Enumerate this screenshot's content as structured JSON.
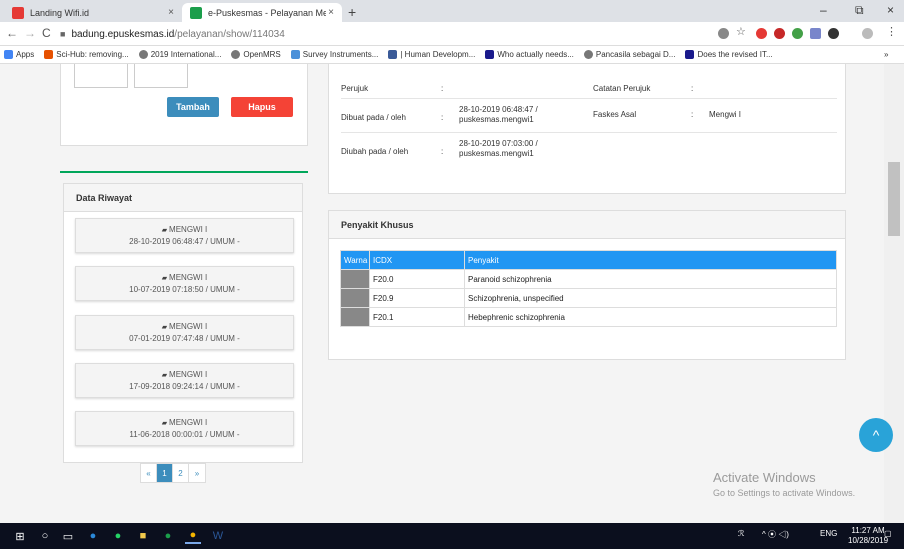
{
  "browser": {
    "tabs": [
      {
        "title": "Landing Wifi.id",
        "close": "×",
        "icon_color": "#e53935"
      },
      {
        "title": "e-Puskesmas - Pelayanan Medis",
        "close": "×",
        "icon_color": "#1b9e4b"
      }
    ],
    "new_tab": "+",
    "window_controls": [
      "–",
      "⧉",
      "×"
    ],
    "nav": {
      "back": "←",
      "forward": "→",
      "reload": "C"
    },
    "url": {
      "host": "badung.epuskesmas.id",
      "path": "/pelayanan/show/114034"
    },
    "bookmarks": [
      {
        "label": "Apps",
        "color": "#4285f4"
      },
      {
        "label": "Sci-Hub: removing...",
        "color": "#e65100"
      },
      {
        "label": "2019 International...",
        "color": "#777777"
      },
      {
        "label": "OpenMRS",
        "color": "#777777"
      },
      {
        "label": "Survey Instruments...",
        "color": "#4a90d9"
      },
      {
        "label": "| Human Developm...",
        "color": "#3a5a98"
      },
      {
        "label": "Who actually needs...",
        "color": "#1a1a8c"
      },
      {
        "label": "Pancasila sebagai D...",
        "color": "#777777"
      },
      {
        "label": "Does the revised IT...",
        "color": "#1a1a8c"
      }
    ],
    "bookmarks_more": "»"
  },
  "left": {
    "add_button": "Tambah",
    "delete_button": "Hapus",
    "riwayat_title": "Data Riwayat",
    "riwayat_items": [
      {
        "title": "MENGWI I",
        "detail": "28-10-2019 06:48:47 / UMUM -"
      },
      {
        "title": "MENGWI I",
        "detail": "10-07-2019 07:18:50 / UMUM -"
      },
      {
        "title": "MENGWI I",
        "detail": "07-01-2019 07:47:48 / UMUM -"
      },
      {
        "title": "MENGWI I",
        "detail": "17-09-2018 09:24:14 / UMUM -"
      },
      {
        "title": "MENGWI I",
        "detail": "11-06-2018 00:00:01 / UMUM -"
      }
    ],
    "pager": {
      "prev": "«",
      "pages": [
        "1",
        "2"
      ],
      "next": "»",
      "current": "1"
    }
  },
  "info": {
    "rows": [
      {
        "label": "Perujuk",
        "sep": ":",
        "value": "",
        "label2": "Catatan Perujuk",
        "sep2": ":",
        "value2": ""
      },
      {
        "label": "Dibuat pada / oleh",
        "sep": ":",
        "value": "28-10-2019 06:48:47 / puskesmas.mengwi1",
        "label2": "Faskes Asal",
        "sep2": ":",
        "value2": "Mengwi I"
      },
      {
        "label": "Diubah pada / oleh",
        "sep": ":",
        "value": "28-10-2019 07:03:00 / puskesmas.mengwi1",
        "label2": "",
        "sep2": "",
        "value2": ""
      }
    ]
  },
  "penyakit": {
    "title": "Penyakit Khusus",
    "columns": [
      "Warna",
      "ICDX",
      "Penyakit"
    ],
    "rows": [
      {
        "icdx": "F20.0",
        "name": "Paranoid schizophrenia"
      },
      {
        "icdx": "F20.9",
        "name": "Schizophrenia, unspecified"
      },
      {
        "icdx": "F20.1",
        "name": "Hebephrenic schizophrenia"
      }
    ]
  },
  "watermark": {
    "line1": "Activate Windows",
    "line2": "Go to Settings to activate Windows."
  },
  "scroll_top": "^",
  "taskbar": {
    "clock_time": "11:27 AM",
    "clock_date": "10/28/2019",
    "language": "ENG",
    "tray": "^ ⦿ ◁)"
  }
}
